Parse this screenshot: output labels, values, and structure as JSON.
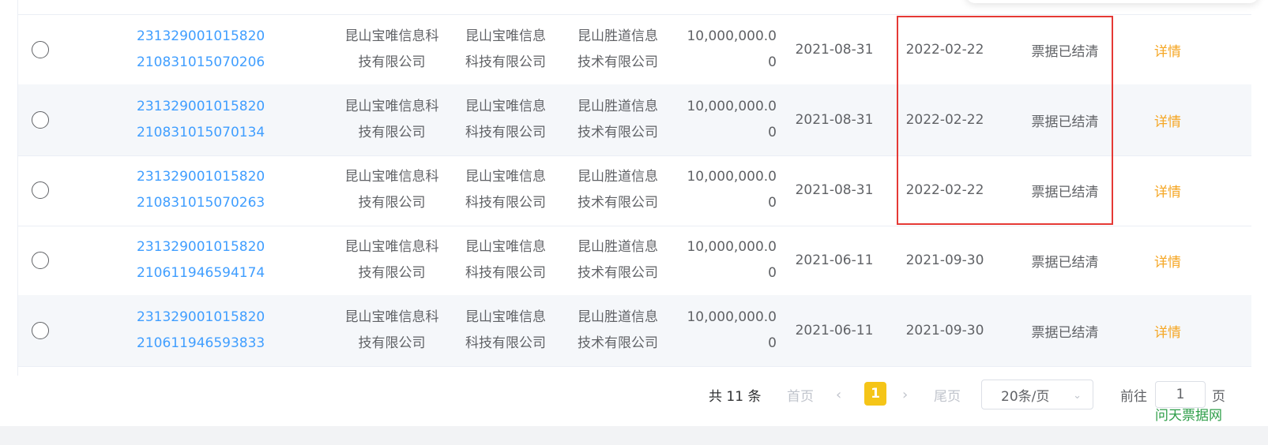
{
  "rows": [
    {
      "no_line1": "231329001015820",
      "no_line2": "210831015070206",
      "drawer_line1": "昆山宝唯信息科",
      "drawer_line2": "技有限公司",
      "acceptor_line1": "昆山宝唯信息",
      "acceptor_line2": "科技有限公司",
      "holder_line1": "昆山胜道信息",
      "holder_line2": "技术有限公司",
      "amount_line1": "10,000,000.0",
      "amount_line2": "0",
      "issue_date": "2021-08-31",
      "due_date": "2022-02-22",
      "status": "票据已结清",
      "detail": "详情"
    },
    {
      "no_line1": "231329001015820",
      "no_line2": "210831015070134",
      "drawer_line1": "昆山宝唯信息科",
      "drawer_line2": "技有限公司",
      "acceptor_line1": "昆山宝唯信息",
      "acceptor_line2": "科技有限公司",
      "holder_line1": "昆山胜道信息",
      "holder_line2": "技术有限公司",
      "amount_line1": "10,000,000.0",
      "amount_line2": "0",
      "issue_date": "2021-08-31",
      "due_date": "2022-02-22",
      "status": "票据已结清",
      "detail": "详情"
    },
    {
      "no_line1": "231329001015820",
      "no_line2": "210831015070263",
      "drawer_line1": "昆山宝唯信息科",
      "drawer_line2": "技有限公司",
      "acceptor_line1": "昆山宝唯信息",
      "acceptor_line2": "科技有限公司",
      "holder_line1": "昆山胜道信息",
      "holder_line2": "技术有限公司",
      "amount_line1": "10,000,000.0",
      "amount_line2": "0",
      "issue_date": "2021-08-31",
      "due_date": "2022-02-22",
      "status": "票据已结清",
      "detail": "详情"
    },
    {
      "no_line1": "231329001015820",
      "no_line2": "210611946594174",
      "drawer_line1": "昆山宝唯信息科",
      "drawer_line2": "技有限公司",
      "acceptor_line1": "昆山宝唯信息",
      "acceptor_line2": "科技有限公司",
      "holder_line1": "昆山胜道信息",
      "holder_line2": "技术有限公司",
      "amount_line1": "10,000,000.0",
      "amount_line2": "0",
      "issue_date": "2021-06-11",
      "due_date": "2021-09-30",
      "status": "票据已结清",
      "detail": "详情"
    },
    {
      "no_line1": "231329001015820",
      "no_line2": "210611946593833",
      "drawer_line1": "昆山宝唯信息科",
      "drawer_line2": "技有限公司",
      "acceptor_line1": "昆山宝唯信息",
      "acceptor_line2": "科技有限公司",
      "holder_line1": "昆山胜道信息",
      "holder_line2": "技术有限公司",
      "amount_line1": "10,000,000.0",
      "amount_line2": "0",
      "issue_date": "2021-06-11",
      "due_date": "2021-09-30",
      "status": "票据已结清",
      "detail": "详情"
    }
  ],
  "pagination": {
    "total": "共 11 条",
    "first": "首页",
    "prev_icon": "chevron-left-icon",
    "current": "1",
    "next_icon": "chevron-right-icon",
    "last": "尾页",
    "page_size": "20条/页",
    "goto_label": "前往",
    "goto_value": "1",
    "page_suffix": "页"
  },
  "watermark": "问天票据网",
  "colors": {
    "link": "#409eff",
    "detail": "#f5a623",
    "current_page": "#f5c518",
    "highlight": "#e53935",
    "watermark": "#2e9e49"
  }
}
